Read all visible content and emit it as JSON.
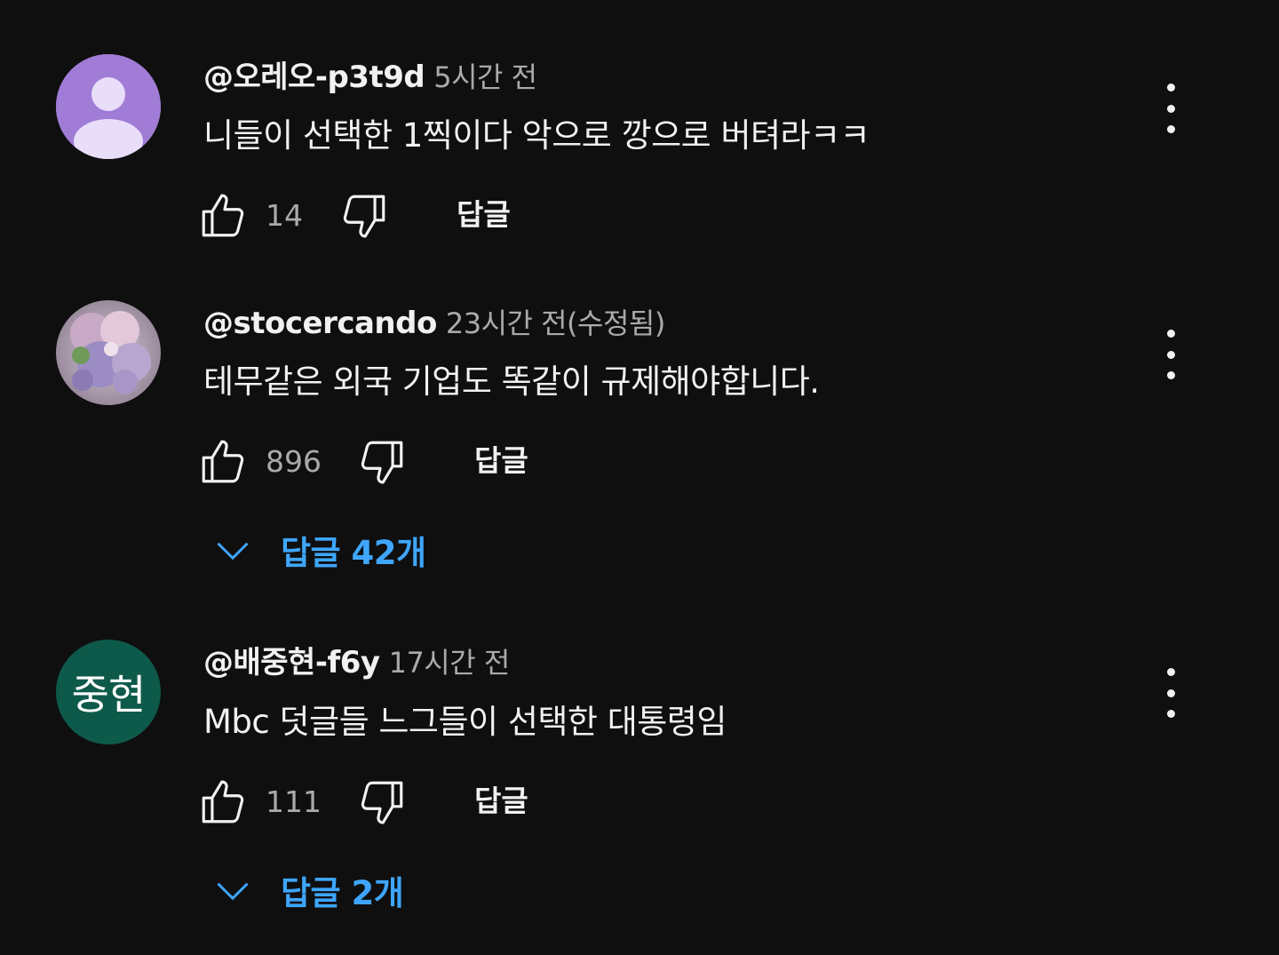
{
  "colors": {
    "background": "#0f0f0f",
    "text_primary": "#f1f1f1",
    "text_secondary": "#aaaaaa",
    "accent_link": "#3ea6ff",
    "avatar_default": "#a07cd6",
    "avatar_initials_bg": "#0e5a4a"
  },
  "comments": [
    {
      "author": "@오레오-p3t9d",
      "time": "5시간 전",
      "text": "니들이 선택한 1찍이다 악으로 깡으로 버텨라ㅋㅋ",
      "likes": "14",
      "reply_label": "답글",
      "avatar_type": "default-person-icon"
    },
    {
      "author": "@stocercando",
      "time": "23시간 전(수정됨)",
      "text": "테무같은 외국 기업도 똑같이 규제해야합니다.",
      "likes": "896",
      "reply_label": "답글",
      "replies_label": "답글 42개",
      "avatar_type": "flower-photo"
    },
    {
      "author": "@배중현-f6y",
      "time": "17시간 전",
      "text": "Mbc 덧글들 느그들이 선택한 대통령임",
      "likes": "111",
      "reply_label": "답글",
      "replies_label": "답글 2개",
      "avatar_initials": "중현"
    }
  ]
}
